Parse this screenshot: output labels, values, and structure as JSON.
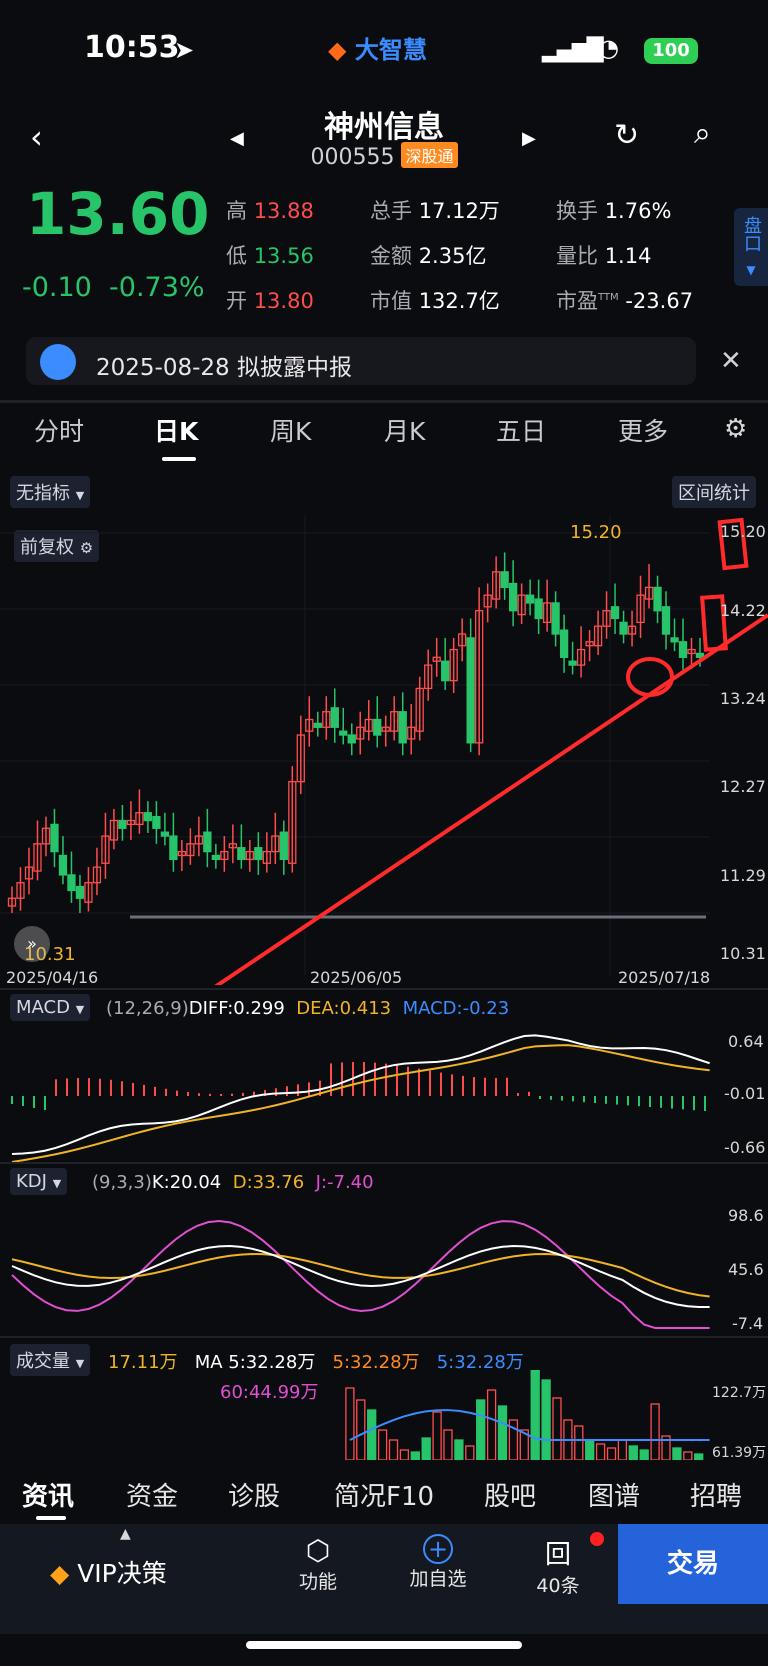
{
  "status_bar": {
    "time": "10:53",
    "brand": "大智慧",
    "battery": "100"
  },
  "header": {
    "title": "神州信息",
    "code": "000555",
    "tag": "深股通"
  },
  "quote": {
    "price": "13.60",
    "change": "-0.10",
    "change_pct": "-0.73%",
    "high_label": "高",
    "high": "13.88",
    "low_label": "低",
    "low": "13.56",
    "open_label": "开",
    "open": "13.80",
    "volume_label": "总手",
    "volume": "17.12万",
    "amount_label": "金额",
    "amount": "2.35亿",
    "mktcap_label": "市值",
    "mktcap": "132.7亿",
    "turnover_label": "换手",
    "turnover": "1.76%",
    "vol_ratio_label": "量比",
    "vol_ratio": "1.14",
    "pe_label": "市盈",
    "pe_sup": "TTM",
    "pe": "-23.67",
    "pankou": "盘口"
  },
  "notice": {
    "text": "2025-08-28 拟披露中报"
  },
  "period_tabs": [
    "分时",
    "日K",
    "周K",
    "月K",
    "五日",
    "更多"
  ],
  "kline": {
    "indicator_chip": "无指标",
    "range_chip": "区间统计",
    "adjust_chip": "前复权",
    "y_ticks": [
      "15.20",
      "14.22",
      "13.24",
      "12.27",
      "11.29",
      "10.31"
    ],
    "x_ticks": [
      "2025/04/16",
      "2025/06/05",
      "2025/07/18"
    ],
    "max_label": "15.20",
    "min_label": "10.31"
  },
  "macd": {
    "chip": "MACD",
    "params": "(12,26,9)",
    "diff": "DIFF:0.299",
    "dea": "DEA:0.413",
    "macd": "MACD:-0.23",
    "y_ticks": [
      "0.64",
      "-0.01",
      "-0.66"
    ]
  },
  "kdj": {
    "chip": "KDJ",
    "params": "(9,3,3)",
    "k": "K:20.04",
    "d": "D:33.76",
    "j": "J:-7.40",
    "y_ticks": [
      "98.6",
      "45.6",
      "-7.4"
    ]
  },
  "vol": {
    "chip": "成交量",
    "value": "17.11万",
    "ma_label": "MA 5:32.28万",
    "ma2": "5:32.28万",
    "ma3": "5:32.28万",
    "ma60": "60:44.99万",
    "y_ticks": [
      "122.7万",
      "61.39万"
    ]
  },
  "bottom_tabs": [
    "资讯",
    "资金",
    "诊股",
    "简况F10",
    "股吧",
    "图谱",
    "招聘"
  ],
  "bottom_bar": {
    "vip": "VIP决策",
    "func": "功能",
    "add": "加自选",
    "review": "40条",
    "trade": "交易"
  },
  "colors": {
    "up": "#ff4d4d",
    "down": "#27c46a",
    "accent": "#3a8cff",
    "dea": "#f0b323",
    "j": "#e04fd0"
  }
}
